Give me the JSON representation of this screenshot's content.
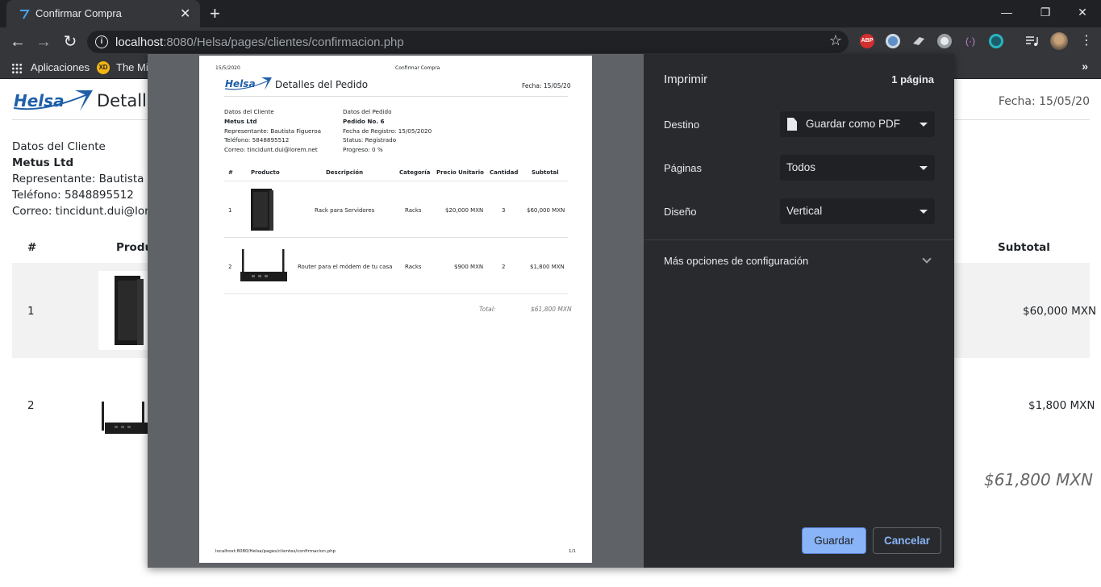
{
  "browser": {
    "tab_title": "Confirmar Compra",
    "tab_close": "✕",
    "new_tab": "+",
    "window_controls": [
      "—",
      "❐",
      "✕"
    ],
    "nav": {
      "back": "←",
      "forward": "→",
      "reload": "↻"
    },
    "url_host": "localhost",
    "url_rest": ":8080/Helsa/pages/clientes/confirmacion.php",
    "info_icon": "i",
    "star_icon": "☆",
    "bookmarks": {
      "apps_label": "Aplicaciones",
      "second_label": "The Mic",
      "xd_badge": "XD",
      "more": "»"
    },
    "extensions": {
      "abp": "ABP"
    }
  },
  "page": {
    "brand": "Helsa",
    "title": "Detalle",
    "date": "Fecha: 15/05/20",
    "client_heading": "Datos del Cliente",
    "client_name": "Metus Ltd",
    "representative": "Representante: Bautista Figu",
    "phone": "Teléfono: 5848895512",
    "email": "Correo: tincidunt.dui@lorem",
    "headers": {
      "num": "#",
      "product": "Produc",
      "subtotal": "Subtotal"
    },
    "rows": [
      {
        "num": "1",
        "subtotal": "$60,000 MXN"
      },
      {
        "num": "2",
        "subtotal": "$1,800 MXN"
      }
    ],
    "total": "$61,800 MXN"
  },
  "preview": {
    "header_date": "15/5/2020",
    "header_title": "Confirmar Compra",
    "brand": "Helsa",
    "title": "Detalles del Pedido",
    "date": "Fecha: 15/05/20",
    "client": {
      "heading": "Datos del Cliente",
      "name": "Metus Ltd",
      "representative": "Representante: Bautista Figueroa",
      "phone": "Teléfono: 5848895512",
      "email": "Correo: tincidunt.dui@lorem.net"
    },
    "order": {
      "heading": "Datos del Pedido",
      "number": "Pedido No. 6",
      "registered": "Fecha de Registro: 15/05/2020",
      "status": "Status: Registrado",
      "progress": "Progreso: 0 %"
    },
    "columns": [
      "#",
      "Producto",
      "Descripción",
      "Categoría",
      "Precio Unitario",
      "Cantidad",
      "Subtotal"
    ],
    "rows": [
      {
        "num": "1",
        "description": "Rack para Servidores",
        "category": "Racks",
        "price": "$20,000 MXN",
        "qty": "3",
        "subtotal": "$60,000 MXN"
      },
      {
        "num": "2",
        "description": "Router para el módem de tu casa",
        "category": "Racks",
        "price": "$900 MXN",
        "qty": "2",
        "subtotal": "$1,800 MXN"
      }
    ],
    "total_label": "Total:",
    "total_value": "$61,800 MXN",
    "footer_url": "localhost:8080/Helsa/pages/clientes/confirmacion.php",
    "footer_page": "1/1"
  },
  "print": {
    "title": "Imprimir",
    "page_count": "1 página",
    "destination_label": "Destino",
    "destination_value": "Guardar como PDF",
    "pages_label": "Páginas",
    "pages_value": "Todos",
    "layout_label": "Diseño",
    "layout_value": "Vertical",
    "more_options": "Más opciones de configuración",
    "save_button": "Guardar",
    "cancel_button": "Cancelar"
  },
  "colors": {
    "chrome_dark": "#202124",
    "chrome_toolbar": "#35363a",
    "dialog_sidebar": "#292a2d",
    "accent_blue": "#8ab4f8",
    "brand_blue": "#1f5fa8"
  }
}
